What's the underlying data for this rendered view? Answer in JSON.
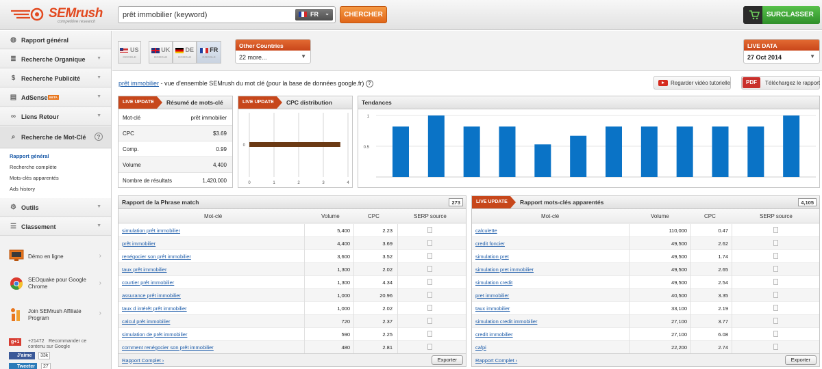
{
  "brand": {
    "name": "SEMrush",
    "tagline": "competitive research"
  },
  "search": {
    "value": "prêt immobilier (keyword)",
    "country": "FR",
    "button": "CHERCHER"
  },
  "upgrade": {
    "label": "SURCLASSER"
  },
  "sidebar": {
    "items": [
      {
        "label": "Rapport général",
        "icon": "globe-icon"
      },
      {
        "label": "Recherche Organique",
        "icon": "bars-icon"
      },
      {
        "label": "Recherche Publicité",
        "icon": "dollar-icon"
      },
      {
        "label": "AdSense",
        "badge": "BETA",
        "icon": "adsense-icon"
      },
      {
        "label": "Liens Retour",
        "icon": "link-icon"
      },
      {
        "label": "Recherche de Mot-Clé",
        "icon": "search-icon"
      }
    ],
    "subitems": [
      "Rapport général",
      "Recherche complète",
      "Mots-clés apparentés",
      "Ads history"
    ],
    "items2": [
      {
        "label": "Outils",
        "icon": "tools-icon"
      },
      {
        "label": "Classement",
        "icon": "list-icon"
      }
    ],
    "promos": [
      {
        "label": "Démo en ligne"
      },
      {
        "label": "SEOquake pour Google Chrome"
      },
      {
        "label": "Join SEMrush Affiliate Program"
      }
    ],
    "social": {
      "gplus": "g+1",
      "gplus_count": "+21472",
      "gplus_text": "Recommander ce contenu sur Google",
      "fb": "J'aime",
      "fb_count": "33k",
      "tw": "Tweeter",
      "tw_count": "27"
    }
  },
  "databases": [
    {
      "code": "US",
      "sub": "GOOGLE"
    },
    {
      "code": "UK",
      "sub": "GOOGLE"
    },
    {
      "code": "DE",
      "sub": "GOOGLE"
    },
    {
      "code": "FR",
      "sub": "GOOGLE"
    }
  ],
  "other_countries": {
    "title": "Other Countries",
    "value": "22 more..."
  },
  "live_data": {
    "title": "LIVE DATA",
    "value": "27 Oct 2014"
  },
  "overview": {
    "keyword_link": "prêt immobilier",
    "text": " - vue d'ensemble SEMrush du mot clé (pour la base de données google.fr)",
    "help": "?",
    "video_btn": "Regarder vidéo tutorielle",
    "pdf_label": "PDF",
    "pdf_btn": "Téléchargez le rapport"
  },
  "live_update": "LIVE UPDATE",
  "summary": {
    "title": "Résumé de mots-clé",
    "rows": [
      {
        "k": "Mot-clé",
        "v": "prêt immobilier"
      },
      {
        "k": "CPC",
        "v": "$3.69"
      },
      {
        "k": "Comp.",
        "v": "0.99"
      },
      {
        "k": "Volume",
        "v": "4,400"
      },
      {
        "k": "Nombre de résultats",
        "v": "1,420,000"
      }
    ]
  },
  "cpc": {
    "title": "CPC distribution",
    "chart_data": {
      "type": "bar",
      "x_ticks": [
        "0",
        "1",
        "2",
        "3",
        "4"
      ],
      "y_tick": "0",
      "value": 3.69,
      "xlim": [
        0,
        4
      ]
    }
  },
  "tendances": {
    "title": "Tendances",
    "chart_data": {
      "type": "bar",
      "y_ticks": [
        "1",
        "0.5"
      ],
      "ylim": [
        0,
        1
      ],
      "values": [
        0.82,
        1.0,
        0.82,
        0.82,
        0.53,
        0.67,
        0.82,
        0.82,
        0.82,
        0.82,
        0.82,
        1.0
      ]
    }
  },
  "phrase_match": {
    "title": "Rapport de la Phrase match",
    "count": "273",
    "headers": [
      "Mot-clé",
      "Volume",
      "CPC",
      "SERP source"
    ],
    "rows": [
      {
        "kw": "simulation prêt immobilier",
        "vol": "5,400",
        "cpc": "2.23"
      },
      {
        "kw": "prêt immobilier",
        "vol": "4,400",
        "cpc": "3.69"
      },
      {
        "kw": "renégocier son prêt immobilier",
        "vol": "3,600",
        "cpc": "3.52"
      },
      {
        "kw": "taux prêt immobilier",
        "vol": "1,300",
        "cpc": "2.02"
      },
      {
        "kw": "courtier prêt immobilier",
        "vol": "1,300",
        "cpc": "4.34"
      },
      {
        "kw": "assurance prêt immobilier",
        "vol": "1,000",
        "cpc": "20.96"
      },
      {
        "kw": "taux d intérêt prêt immobilier",
        "vol": "1,000",
        "cpc": "2.02"
      },
      {
        "kw": "calcul prêt immobilier",
        "vol": "720",
        "cpc": "2.37"
      },
      {
        "kw": "simulation de prêt immobilier",
        "vol": "590",
        "cpc": "2.25"
      },
      {
        "kw": "comment renégocier son prêt immobilier",
        "vol": "480",
        "cpc": "2.81"
      }
    ],
    "footer_link": "Rapport Complet ›",
    "export": "Exporter"
  },
  "related": {
    "title": "Rapport mots-clés apparentés",
    "count": "4,105",
    "headers": [
      "Mot-clé",
      "Volume",
      "CPC",
      "SERP source"
    ],
    "rows": [
      {
        "kw": "calculette",
        "vol": "110,000",
        "cpc": "0.47"
      },
      {
        "kw": "credit foncier",
        "vol": "49,500",
        "cpc": "2.62"
      },
      {
        "kw": "simulation pret",
        "vol": "49,500",
        "cpc": "1.74"
      },
      {
        "kw": "simulation pret immobilier",
        "vol": "49,500",
        "cpc": "2.65"
      },
      {
        "kw": "simulation credit",
        "vol": "49,500",
        "cpc": "2.54"
      },
      {
        "kw": "pret immobilier",
        "vol": "40,500",
        "cpc": "3.35"
      },
      {
        "kw": "taux immobilier",
        "vol": "33,100",
        "cpc": "2.19"
      },
      {
        "kw": "simulation credit immobilier",
        "vol": "27,100",
        "cpc": "3.77"
      },
      {
        "kw": "credit immobilier",
        "vol": "27,100",
        "cpc": "6.08"
      },
      {
        "kw": "cafpi",
        "vol": "22,200",
        "cpc": "2.74"
      }
    ],
    "footer_link": "Rapport Complet ›",
    "export": "Exporter"
  }
}
